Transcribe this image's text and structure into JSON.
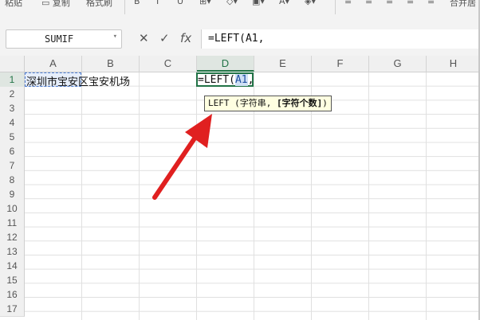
{
  "ribbon": {
    "paste_label": "粘贴",
    "copy_label": "复制",
    "format_painter_label": "格式刷",
    "merge_label": "合并居"
  },
  "formula_bar": {
    "name_box": "SUMIF",
    "cancel_glyph": "✕",
    "enter_glyph": "✓",
    "fx_label": "fx",
    "formula_text": "=LEFT(A1,"
  },
  "columns": [
    "A",
    "B",
    "C",
    "D",
    "E",
    "F",
    "G",
    "H"
  ],
  "active_column": "D",
  "rows": [
    "1",
    "2",
    "3",
    "4",
    "5",
    "6",
    "7",
    "8",
    "9",
    "10",
    "11",
    "12",
    "13",
    "14",
    "15",
    "16",
    "17"
  ],
  "active_row": "1",
  "cells": {
    "A1": "深圳市宝安区宝安机场",
    "D1_prefix": "=LEFT(",
    "D1_ref": "A1",
    "D1_suffix": ","
  },
  "tooltip": {
    "func": "LEFT",
    "arg1": "(字符串,",
    "arg2": "[字符个数]",
    "close": ")"
  },
  "colors": {
    "accent_green": "#217346",
    "arrow_red": "#e02020",
    "tooltip_bg": "#ffffe1"
  }
}
